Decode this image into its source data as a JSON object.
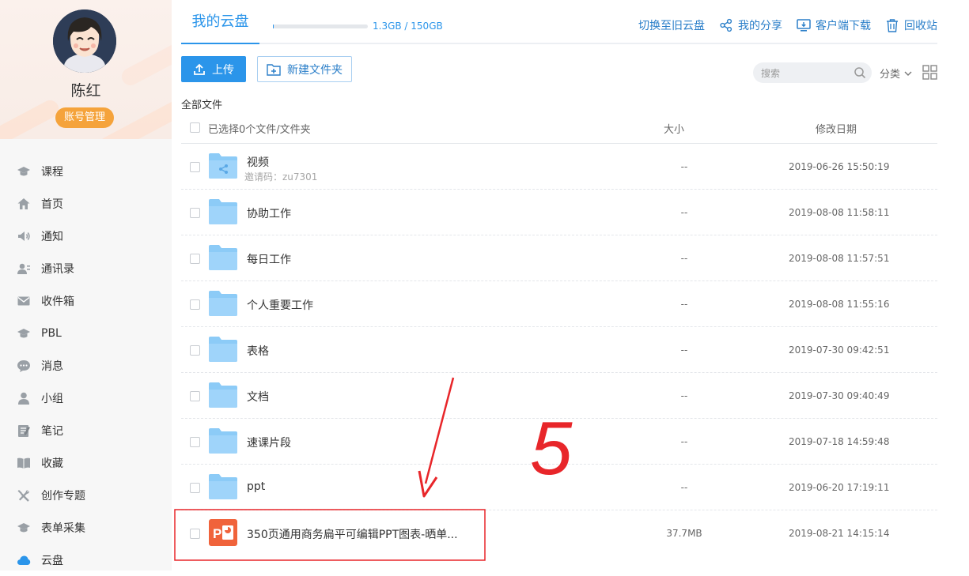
{
  "user": {
    "name": "陈红",
    "account_button": "账号管理"
  },
  "sidebar": {
    "items": [
      {
        "label": "课程",
        "icon": "graduation-cap-icon"
      },
      {
        "label": "首页",
        "icon": "home-icon"
      },
      {
        "label": "通知",
        "icon": "speaker-icon"
      },
      {
        "label": "通讯录",
        "icon": "contacts-icon"
      },
      {
        "label": "收件箱",
        "icon": "inbox-icon"
      },
      {
        "label": "PBL",
        "icon": "graduation-cap-icon"
      },
      {
        "label": "消息",
        "icon": "chat-bubble-icon"
      },
      {
        "label": "小组",
        "icon": "person-icon"
      },
      {
        "label": "笔记",
        "icon": "notebook-icon"
      },
      {
        "label": "收藏",
        "icon": "book-icon"
      },
      {
        "label": "创作专题",
        "icon": "tools-icon"
      },
      {
        "label": "表单采集",
        "icon": "graduation-cap-icon"
      },
      {
        "label": "云盘",
        "icon": "cloud-icon",
        "active": true
      }
    ]
  },
  "header": {
    "tab_title": "我的云盘",
    "storage_text": "1.3GB / 150GB",
    "storage_used_fraction": 0.0087,
    "actions": {
      "switch_old": "切换至旧云盘",
      "my_share": "我的分享",
      "client_download": "客户端下载",
      "recycle_bin": "回收站"
    }
  },
  "toolbar": {
    "upload_label": "上传",
    "new_folder_label": "新建文件夹",
    "search_placeholder": "搜索",
    "sort_label": "分类"
  },
  "breadcrumb": "全部文件",
  "table": {
    "selected_text": "已选择0个文件/文件夹",
    "col_size": "大小",
    "col_date": "修改日期",
    "rows": [
      {
        "name": "视频",
        "sub": "邀请码：zu7301",
        "size": "--",
        "date": "2019-06-26 15:50:19",
        "type": "shared-folder"
      },
      {
        "name": "协助工作",
        "size": "--",
        "date": "2019-08-08 11:58:11",
        "type": "folder"
      },
      {
        "name": "每日工作",
        "size": "--",
        "date": "2019-08-08 11:57:51",
        "type": "folder"
      },
      {
        "name": "个人重要工作",
        "size": "--",
        "date": "2019-08-08 11:55:16",
        "type": "folder"
      },
      {
        "name": "表格",
        "size": "--",
        "date": "2019-07-30 09:42:51",
        "type": "folder"
      },
      {
        "name": "文档",
        "size": "--",
        "date": "2019-07-30 09:40:49",
        "type": "folder"
      },
      {
        "name": "速课片段",
        "size": "--",
        "date": "2019-07-18 14:59:48",
        "type": "folder"
      },
      {
        "name": "ppt",
        "size": "--",
        "date": "2019-06-20 17:19:11",
        "type": "folder"
      },
      {
        "name": "350页通用商务扁平可编辑PPT图表-晒单...",
        "size": "37.7MB",
        "date": "2019-08-21 14:15:14",
        "type": "ppt"
      }
    ]
  },
  "annotation": {
    "label": "5",
    "color": "#e8262a"
  },
  "colors": {
    "accent": "#2b95ea",
    "account_button": "#f5a33b",
    "folder": "#8ccbf7",
    "ppt": "#f0633b"
  }
}
